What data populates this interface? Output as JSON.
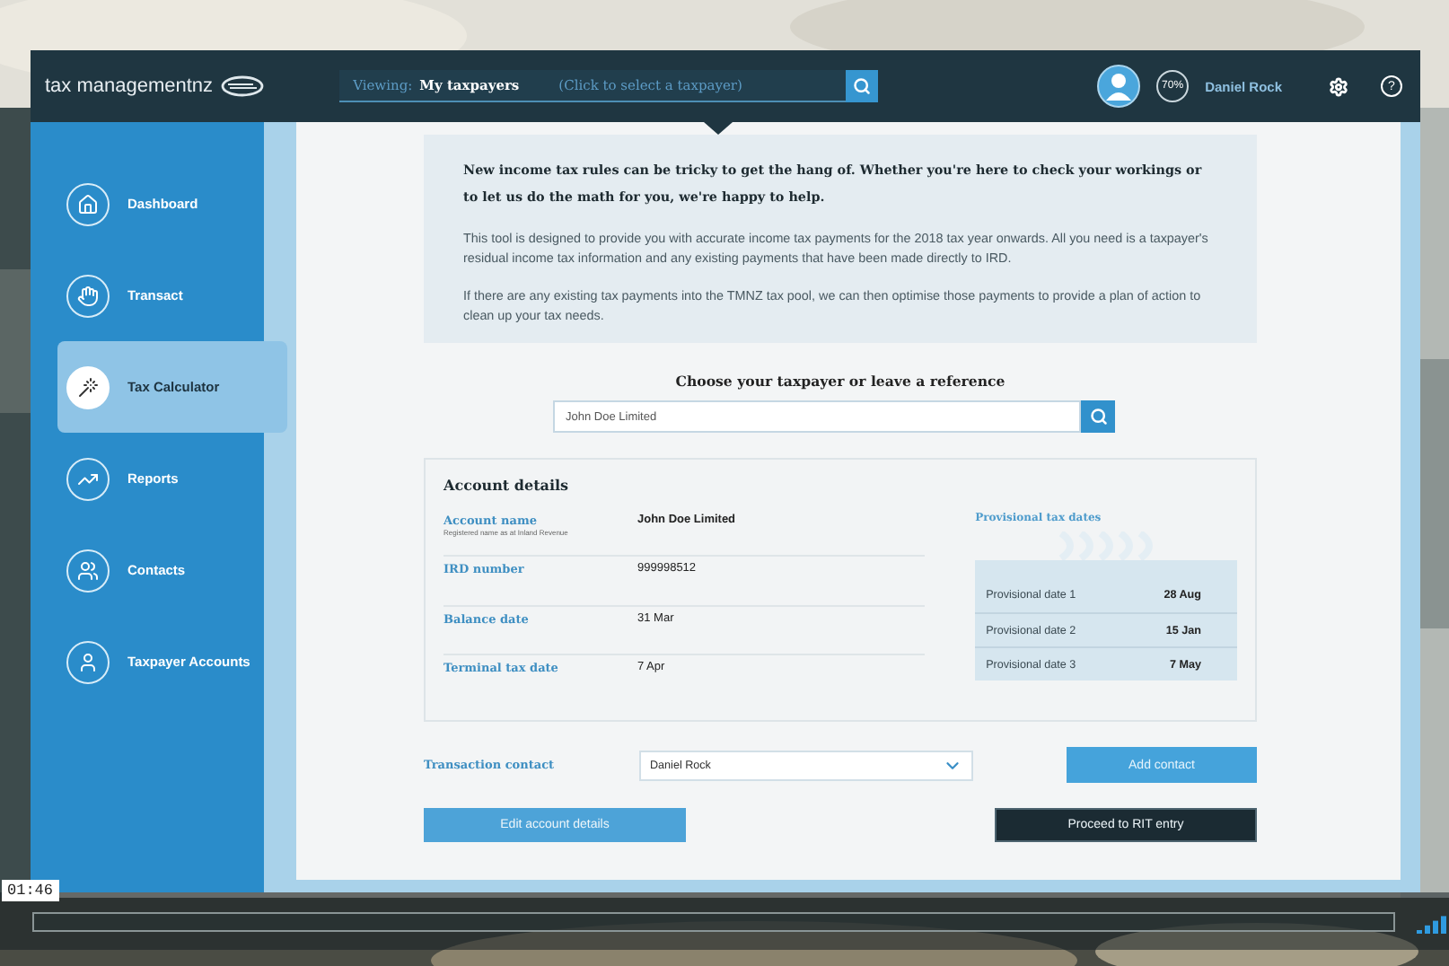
{
  "header": {
    "logo": "tax managementnz",
    "viewing_label": "Viewing:",
    "viewing_value": "My taxpayers",
    "viewing_hint": "(Click to select a taxpayer)",
    "progress_badge": "70%",
    "user_name": "Daniel Rock",
    "help": "?"
  },
  "sidebar": {
    "items": [
      {
        "label": "Dashboard",
        "selected": false
      },
      {
        "label": "Transact",
        "selected": false
      },
      {
        "label": "Tax Calculator",
        "selected": true
      },
      {
        "label": "Reports",
        "selected": false
      },
      {
        "label": "Contacts",
        "selected": false
      },
      {
        "label": "Taxpayer Accounts",
        "selected": false
      }
    ]
  },
  "intro": {
    "heading": "New income tax rules can be tricky to get the hang of. Whether you're here to check your workings or to let us do the math for you, we're happy to help.",
    "paragraphs": [
      "This tool is designed to provide you with accurate income tax payments for the 2018 tax year onwards. All you need is a taxpayer's residual income tax information and any existing payments that have been made directly to IRD.",
      "If there are any existing tax payments into the TMNZ tax pool, we can then optimise those payments to provide a plan of action to clean up your tax needs."
    ]
  },
  "taxpayer_search": {
    "title": "Choose your taxpayer or leave a reference",
    "value": "John Doe Limited"
  },
  "account_details": {
    "title": "Account details",
    "rows": [
      {
        "label": "Account name",
        "note": "Registered name as at Inland Revenue",
        "value": "John Doe Limited"
      },
      {
        "label": "IRD number",
        "value": "999998512"
      },
      {
        "label": "Balance date",
        "value": "31 Mar"
      },
      {
        "label": "Terminal tax date",
        "value": "7 Apr"
      }
    ],
    "provisional": {
      "title": "Provisional tax dates",
      "rows": [
        {
          "label": "Provisional date 1",
          "value": "28 Aug"
        },
        {
          "label": "Provisional date 2",
          "value": "15 Jan"
        },
        {
          "label": "Provisional date 3",
          "value": "7 May"
        }
      ]
    }
  },
  "transaction_contact": {
    "label": "Transaction contact",
    "value": "Daniel Rock",
    "button": "Add contact"
  },
  "actions": [
    {
      "label": "Edit account details",
      "kind": "secondary"
    },
    {
      "label": "Proceed to RIT entry",
      "kind": "primary"
    }
  ],
  "video": {
    "time": "01:46"
  }
}
